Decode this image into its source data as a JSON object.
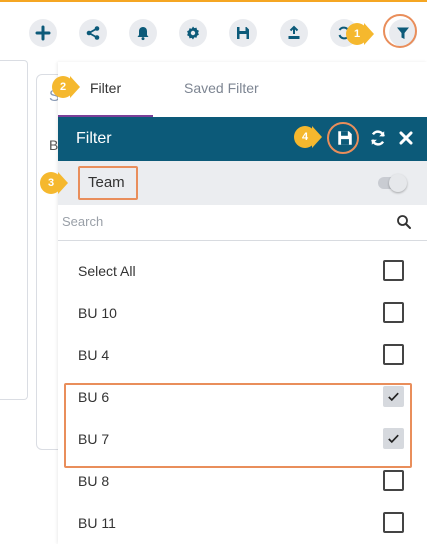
{
  "toolbar": {
    "buttons": [
      {
        "name": "add",
        "icon": "plus-icon"
      },
      {
        "name": "share",
        "icon": "share-icon"
      },
      {
        "name": "notifications",
        "icon": "bell-icon"
      },
      {
        "name": "settings",
        "icon": "gear-icon"
      },
      {
        "name": "save",
        "icon": "save-icon"
      },
      {
        "name": "export",
        "icon": "export-icon"
      },
      {
        "name": "refresh",
        "icon": "refresh-icon"
      },
      {
        "name": "filter",
        "icon": "filter-icon"
      }
    ]
  },
  "background": {
    "card_letter": "S",
    "row_letter": "B"
  },
  "tabs": [
    {
      "label": "Filter",
      "active": true
    },
    {
      "label": "Saved Filter",
      "active": false
    }
  ],
  "filter_panel": {
    "title": "Filter",
    "header_icons": [
      "save-icon",
      "refresh-icon",
      "close-icon"
    ],
    "team": {
      "label": "Team",
      "toggle_on": true
    },
    "search": {
      "placeholder": "Search",
      "value": ""
    },
    "items": [
      {
        "label": "Select All",
        "checked": false
      },
      {
        "label": "BU 10",
        "checked": false
      },
      {
        "label": "BU 4",
        "checked": false
      },
      {
        "label": "BU 6",
        "checked": true
      },
      {
        "label": "BU 7",
        "checked": true
      },
      {
        "label": "BU 8",
        "checked": false
      },
      {
        "label": "BU 11",
        "checked": false
      }
    ]
  },
  "annotations": {
    "markers": [
      "1",
      "2",
      "3",
      "4"
    ]
  },
  "colors": {
    "header": "#0c5a79",
    "annotation_highlight": "#e98e5b",
    "marker": "#f5b82e",
    "tab_underline": "#7b3f98"
  }
}
